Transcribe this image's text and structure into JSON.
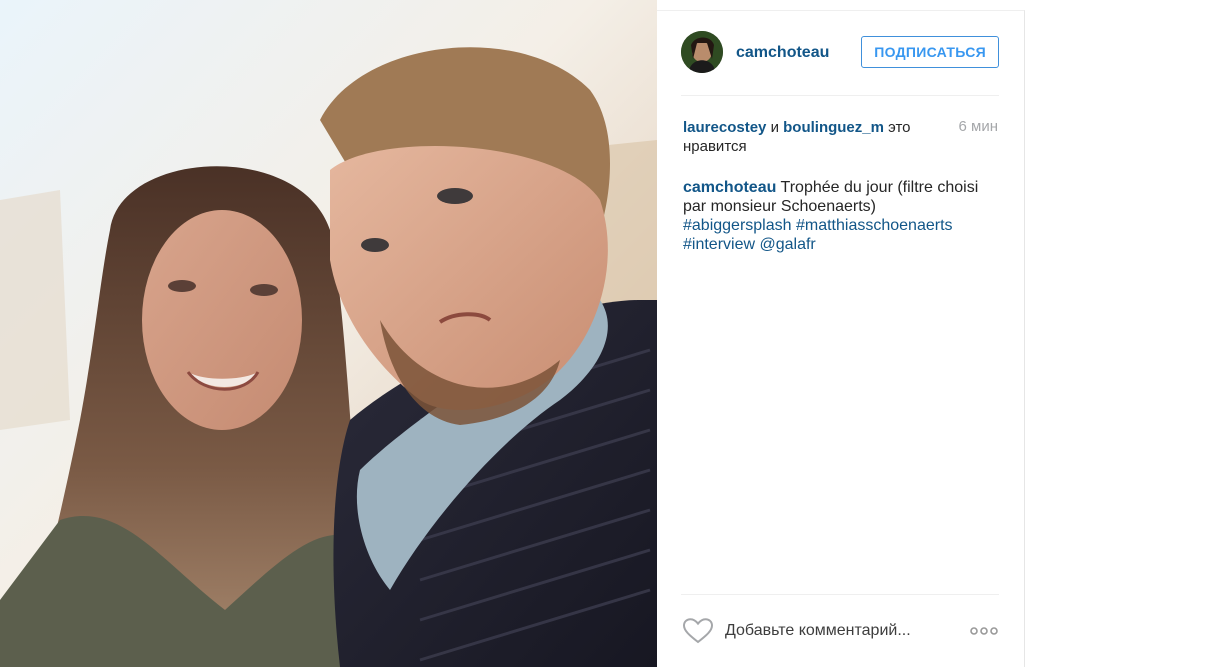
{
  "post": {
    "photo_alt": "",
    "header": {
      "username": "camchoteau",
      "follow_label": "ПОДПИСАТЬСЯ"
    },
    "likes": {
      "user1": "laurecostey",
      "connector": "и",
      "user2": "boulinguez_m",
      "suffix": "это нравится"
    },
    "time": "6 мин",
    "caption": {
      "author": "camchoteau",
      "text": "Trophée du jour (filtre choisi par monsieur Schoenaerts)",
      "tags": [
        "#abiggersplash",
        "#matthiasschoenaerts",
        "#interview",
        "@galafr"
      ]
    },
    "comment": {
      "placeholder": "Добавьте комментарий..."
    }
  },
  "icons": {
    "like": "heart-icon",
    "options": "more-options-icon",
    "avatar": "avatar"
  },
  "colors": {
    "link": "#125688",
    "accent": "#3897f0",
    "muted": "#a5a7aa"
  }
}
